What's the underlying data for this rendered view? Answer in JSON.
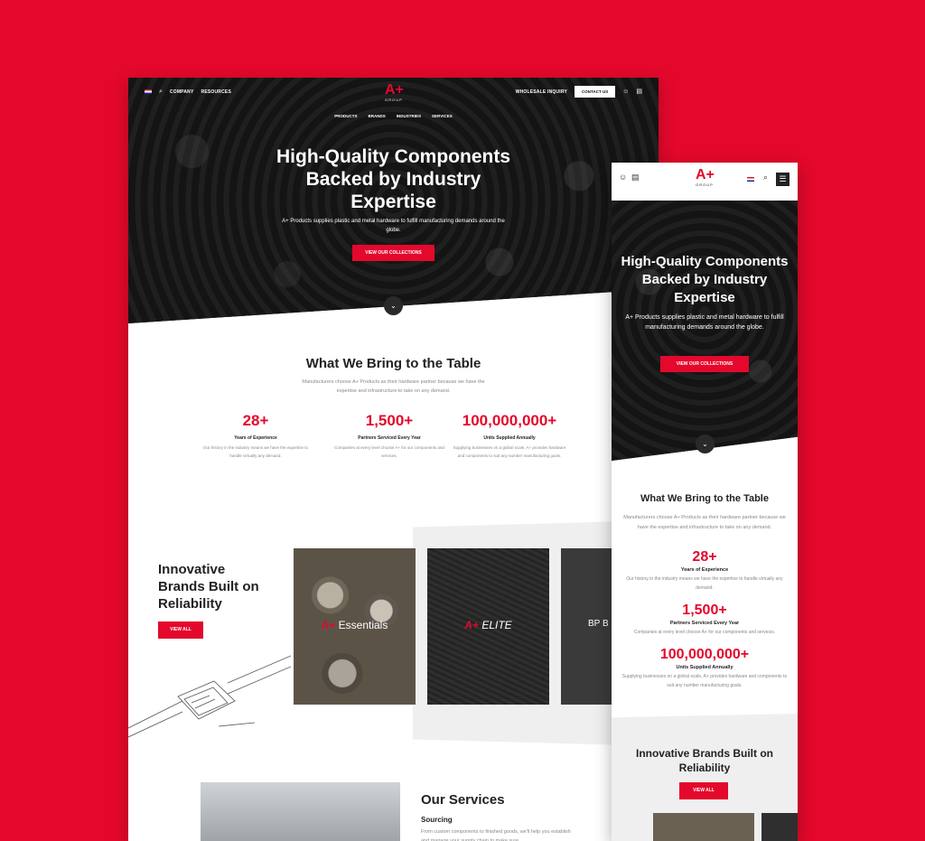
{
  "desktop": {
    "nav": {
      "company": "COMPANY",
      "resources": "RESOURCES",
      "wholesale": "WHOLESALE INQUIRY",
      "contact": "CONTACT US",
      "logo_mark": "A+",
      "logo_sub": "GROUP",
      "menu": [
        "PRODUCTS",
        "BRANDS",
        "INDUSTRIES",
        "SERVICES"
      ]
    },
    "hero": {
      "title": "High-Quality Components Backed by Industry Expertise",
      "subtitle": "A+ Products supplies plastic and metal hardware to fulfill manufacturing demands around the globe.",
      "cta": "VIEW OUR COLLECTIONS"
    },
    "bring": {
      "title": "What We Bring to the Table",
      "subtitle": "Manufacturers choose A+ Products as their hardware partner because we have the expertise and infrastructure to take on any demand.",
      "stats": [
        {
          "num": "28+",
          "label": "Years of Experience",
          "desc": "Our history in the industry means we have the expertise to handle virtually any demand."
        },
        {
          "num": "1,500+",
          "label": "Partners Serviced Every Year",
          "desc": "Companies at every level choose A+ for our components and services."
        },
        {
          "num": "100,000,000+",
          "label": "Units Supplied Annually",
          "desc": "Supplying businesses on a global scale, A+ provides hardware and components to suit any number manufacturing goals."
        }
      ]
    },
    "brands": {
      "title": "Innovative Brands Built on Reliability",
      "cta": "VIEW ALL",
      "cards": [
        {
          "prefix": "A+",
          "name": "Essentials"
        },
        {
          "prefix": "A+",
          "name": "ELITE"
        },
        {
          "prefix": "",
          "name": "BP B"
        }
      ]
    },
    "services": {
      "title": "Our Services",
      "subtitle": "Sourcing",
      "desc": "From custom components to finished goods, we'll help you establish and manage your supply chain to make sure."
    }
  },
  "mobile": {
    "logo_mark": "A+",
    "logo_sub": "GROUP",
    "hero": {
      "title": "High-Quality Components Backed by Industry Expertise",
      "subtitle": "A+ Products supplies plastic and metal hardware to fulfill manufacturing demands around the globe.",
      "cta": "VIEW OUR COLLECTIONS"
    },
    "bring": {
      "title": "What We Bring to the Table",
      "subtitle": "Manufacturers choose A+ Products as their hardware partner because we have the expertise and infrastructure to take on any demand.",
      "stats": [
        {
          "num": "28+",
          "label": "Years of Experience",
          "desc": "Our history in the industry means we have the expertise to handle virtually any demand."
        },
        {
          "num": "1,500+",
          "label": "Partners Serviced Every Year",
          "desc": "Companies at every level choose A+ for our components and services."
        },
        {
          "num": "100,000,000+",
          "label": "Units Supplied Annually",
          "desc": "Supplying businesses on a global scale, A+ provides hardware and components to suit any number manufacturing goals."
        }
      ]
    },
    "brands": {
      "title": "Innovative Brands Built on Reliability",
      "cta": "VIEW ALL"
    }
  },
  "icons": {
    "search": "⌕",
    "user": "👤",
    "cart": "🛒",
    "chevron": "⌄",
    "menu": "☰"
  },
  "colors": {
    "brand_red": "#e4082c",
    "dark": "#222222"
  }
}
